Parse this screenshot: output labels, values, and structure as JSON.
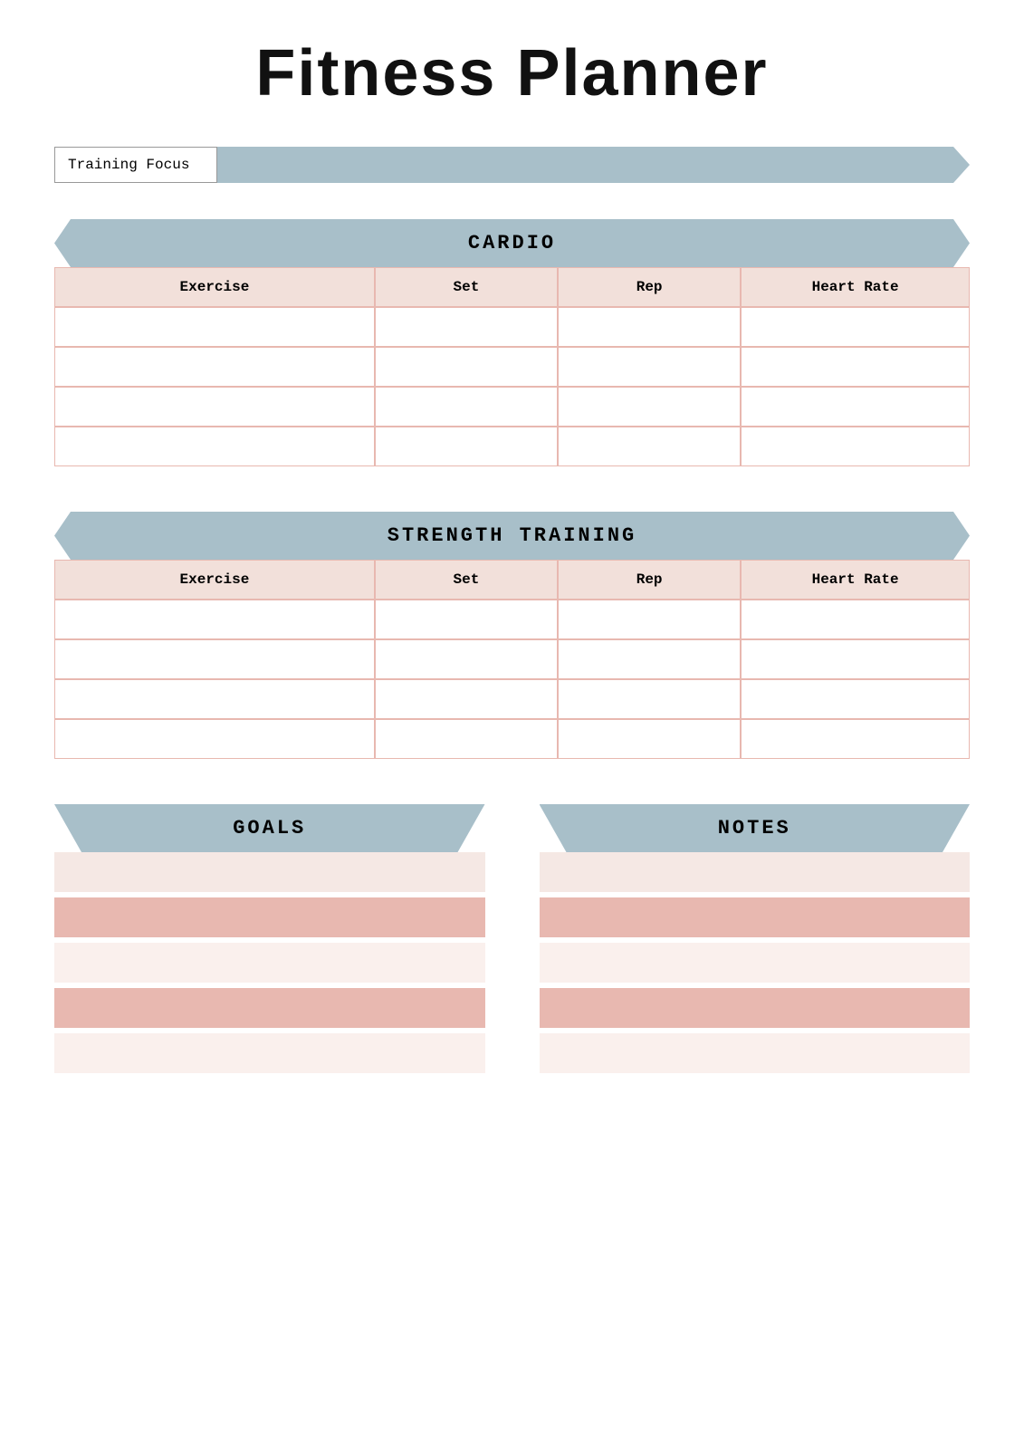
{
  "title": "Fitness Planner",
  "training_focus": {
    "label": "Training Focus"
  },
  "cardio": {
    "header": "CARDIO",
    "columns": [
      "Exercise",
      "Set",
      "Rep",
      "Heart Rate"
    ],
    "rows": 4
  },
  "strength": {
    "header": "STRENGTH TRAINING",
    "columns": [
      "Exercise",
      "Set",
      "Rep",
      "Heart Rate"
    ],
    "rows": 4
  },
  "goals": {
    "header": "GOALS"
  },
  "notes": {
    "header": "NOTES"
  },
  "bottom_rows": [
    "light",
    "medium",
    "lighter",
    "medium",
    "lighter"
  ]
}
